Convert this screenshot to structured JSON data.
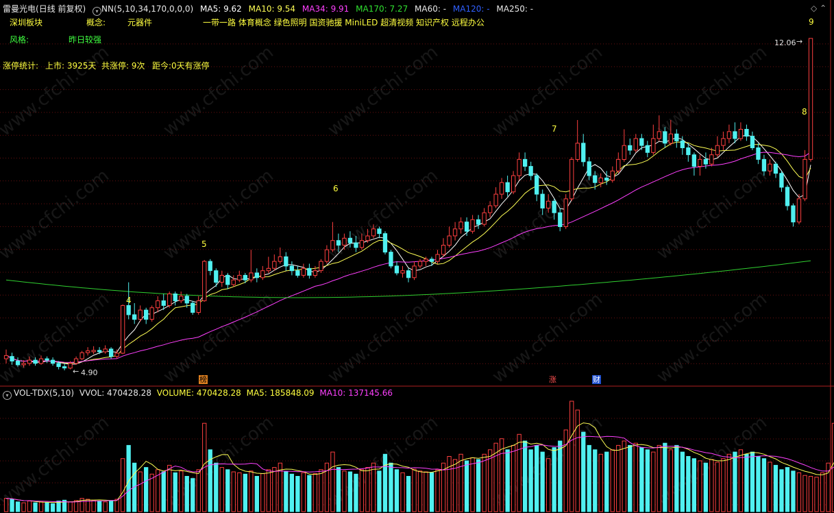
{
  "colors": {
    "up": "#ff4040",
    "down": "#50f0f0",
    "ma5": "#ffffff",
    "ma10": "#ffff55",
    "ma34": "#ff40ff",
    "ma170": "#30d030",
    "ma60": "#cccccc",
    "ma120": "#3060ff",
    "ma250": "#cccccc",
    "grid": "#6a1010",
    "yellow": "#ffff40",
    "green": "#40ff40"
  },
  "header": {
    "stock_name": "雷曼光电",
    "mode": "(日线 前复权)",
    "indicator": "NN(5,10,34,170,0,0,0)",
    "ma5": "MA5: 9.62",
    "ma10": "MA10: 9.54",
    "ma34": "MA34: 9.91",
    "ma170": "MA170: 7.27",
    "ma60": "MA60: -",
    "ma120": "MA120: -",
    "ma250": "MA250: -"
  },
  "info": {
    "sector_label": "深圳板块",
    "concept_label": "概念:",
    "concept_value": "元器件",
    "concepts": "一带一路 体育概念 绿色照明 国资驰援 MiniLED 超清视频 知识产权 远程办公",
    "style_label": "风格:",
    "style_value": "昨日较强",
    "limit_stats_label": "涨停统计:",
    "listed": "上市: 3925天",
    "limit_count": "共涨停: 9次",
    "since_last": "距今:0天有涨停"
  },
  "annotations": {
    "high_price": "12.06",
    "low_price": "4.90",
    "numbers": [
      "4",
      "5",
      "6",
      "7",
      "8",
      "9"
    ],
    "markers": [
      "榜",
      "涨",
      "财"
    ]
  },
  "volume_header": {
    "name": "VOL-TDX(5,10)",
    "vvol": "VVOL: 470428.28",
    "volume": "VOLUME: 470428.28",
    "ma5": "MA5: 185848.09",
    "ma10": "MA10: 137145.66"
  },
  "watermark": "www.cfchi.com",
  "chart_data": {
    "type": "candlestick",
    "price_range": [
      4.9,
      12.06
    ],
    "candles": [
      {
        "o": 5.15,
        "c": 5.22,
        "h": 5.35,
        "l": 5.05
      },
      {
        "o": 5.2,
        "c": 5.1,
        "h": 5.28,
        "l": 5.02
      },
      {
        "o": 5.1,
        "c": 5.02,
        "h": 5.18,
        "l": 4.98
      },
      {
        "o": 5.02,
        "c": 5.05,
        "h": 5.12,
        "l": 4.96
      },
      {
        "o": 5.05,
        "c": 5.12,
        "h": 5.2,
        "l": 5.0
      },
      {
        "o": 5.12,
        "c": 5.05,
        "h": 5.18,
        "l": 5.0
      },
      {
        "o": 5.05,
        "c": 5.15,
        "h": 5.22,
        "l": 5.02
      },
      {
        "o": 5.15,
        "c": 5.12,
        "h": 5.2,
        "l": 5.06
      },
      {
        "o": 5.12,
        "c": 5.05,
        "h": 5.18,
        "l": 5.0
      },
      {
        "o": 5.05,
        "c": 4.98,
        "h": 5.1,
        "l": 4.92
      },
      {
        "o": 4.98,
        "c": 4.95,
        "h": 5.05,
        "l": 4.9
      },
      {
        "o": 4.95,
        "c": 5.05,
        "h": 5.1,
        "l": 4.92
      },
      {
        "o": 5.05,
        "c": 5.15,
        "h": 5.2,
        "l": 5.02
      },
      {
        "o": 5.15,
        "c": 5.28,
        "h": 5.32,
        "l": 5.12
      },
      {
        "o": 5.28,
        "c": 5.32,
        "h": 5.4,
        "l": 5.22
      },
      {
        "o": 5.3,
        "c": 5.33,
        "h": 5.42,
        "l": 5.25
      },
      {
        "o": 5.33,
        "c": 5.3,
        "h": 5.4,
        "l": 5.25
      },
      {
        "o": 5.3,
        "c": 5.36,
        "h": 5.44,
        "l": 5.26
      },
      {
        "o": 5.36,
        "c": 5.2,
        "h": 5.4,
        "l": 5.15
      },
      {
        "o": 5.2,
        "c": 5.27,
        "h": 5.35,
        "l": 5.15
      },
      {
        "o": 5.27,
        "c": 6.3,
        "h": 6.32,
        "l": 5.25
      },
      {
        "o": 6.3,
        "c": 6.1,
        "h": 6.8,
        "l": 6.0
      },
      {
        "o": 6.1,
        "c": 6.0,
        "h": 6.35,
        "l": 5.9
      },
      {
        "o": 6.0,
        "c": 6.2,
        "h": 6.3,
        "l": 5.95
      },
      {
        "o": 6.2,
        "c": 6.0,
        "h": 6.25,
        "l": 5.9
      },
      {
        "o": 6.0,
        "c": 6.25,
        "h": 6.3,
        "l": 5.95
      },
      {
        "o": 6.25,
        "c": 6.4,
        "h": 6.5,
        "l": 6.15
      },
      {
        "o": 6.4,
        "c": 6.3,
        "h": 6.55,
        "l": 6.2
      },
      {
        "o": 6.3,
        "c": 6.55,
        "h": 6.6,
        "l": 6.25
      },
      {
        "o": 6.55,
        "c": 6.4,
        "h": 6.6,
        "l": 6.3
      },
      {
        "o": 6.4,
        "c": 6.5,
        "h": 6.6,
        "l": 6.35
      },
      {
        "o": 6.5,
        "c": 6.35,
        "h": 6.55,
        "l": 6.25
      },
      {
        "o": 6.35,
        "c": 6.15,
        "h": 6.4,
        "l": 6.1
      },
      {
        "o": 6.15,
        "c": 6.4,
        "h": 6.5,
        "l": 6.1
      },
      {
        "o": 6.4,
        "c": 7.25,
        "h": 7.28,
        "l": 6.38
      },
      {
        "o": 7.25,
        "c": 7.05,
        "h": 7.3,
        "l": 6.95
      },
      {
        "o": 7.05,
        "c": 6.8,
        "h": 7.1,
        "l": 6.7
      },
      {
        "o": 6.8,
        "c": 6.95,
        "h": 7.05,
        "l": 6.7
      },
      {
        "o": 6.95,
        "c": 6.75,
        "h": 7.0,
        "l": 6.65
      },
      {
        "o": 6.75,
        "c": 6.85,
        "h": 6.95,
        "l": 6.7
      },
      {
        "o": 6.85,
        "c": 6.95,
        "h": 7.05,
        "l": 6.8
      },
      {
        "o": 6.95,
        "c": 6.85,
        "h": 7.0,
        "l": 6.78
      },
      {
        "o": 6.85,
        "c": 7.0,
        "h": 7.5,
        "l": 6.8
      },
      {
        "o": 7.0,
        "c": 6.9,
        "h": 7.1,
        "l": 6.8
      },
      {
        "o": 6.9,
        "c": 7.05,
        "h": 7.15,
        "l": 6.85
      },
      {
        "o": 7.05,
        "c": 7.1,
        "h": 7.35,
        "l": 7.0
      },
      {
        "o": 7.1,
        "c": 7.25,
        "h": 7.4,
        "l": 7.05
      },
      {
        "o": 7.25,
        "c": 7.35,
        "h": 7.55,
        "l": 7.2
      },
      {
        "o": 7.35,
        "c": 7.15,
        "h": 7.45,
        "l": 7.05
      },
      {
        "o": 7.15,
        "c": 7.05,
        "h": 7.25,
        "l": 6.95
      },
      {
        "o": 7.05,
        "c": 6.95,
        "h": 7.15,
        "l": 6.9
      },
      {
        "o": 6.95,
        "c": 7.1,
        "h": 7.2,
        "l": 6.9
      },
      {
        "o": 7.1,
        "c": 6.95,
        "h": 7.2,
        "l": 6.88
      },
      {
        "o": 6.95,
        "c": 7.05,
        "h": 7.15,
        "l": 6.9
      },
      {
        "o": 7.05,
        "c": 7.25,
        "h": 7.3,
        "l": 7.0
      },
      {
        "o": 7.25,
        "c": 7.5,
        "h": 7.6,
        "l": 7.2
      },
      {
        "o": 7.5,
        "c": 7.7,
        "h": 8.1,
        "l": 7.45
      },
      {
        "o": 7.7,
        "c": 7.6,
        "h": 7.85,
        "l": 7.45
      },
      {
        "o": 7.6,
        "c": 7.75,
        "h": 7.85,
        "l": 7.5
      },
      {
        "o": 7.75,
        "c": 7.65,
        "h": 7.9,
        "l": 7.55
      },
      {
        "o": 7.65,
        "c": 7.55,
        "h": 7.8,
        "l": 7.45
      },
      {
        "o": 7.55,
        "c": 7.7,
        "h": 7.85,
        "l": 7.5
      },
      {
        "o": 7.7,
        "c": 7.8,
        "h": 7.95,
        "l": 7.65
      },
      {
        "o": 7.8,
        "c": 7.95,
        "h": 8.05,
        "l": 7.75
      },
      {
        "o": 7.95,
        "c": 7.85,
        "h": 8.0,
        "l": 7.75
      },
      {
        "o": 7.85,
        "c": 7.45,
        "h": 7.9,
        "l": 7.4
      },
      {
        "o": 7.45,
        "c": 7.15,
        "h": 7.5,
        "l": 7.1
      },
      {
        "o": 7.15,
        "c": 7.0,
        "h": 7.25,
        "l": 6.95
      },
      {
        "o": 7.0,
        "c": 7.05,
        "h": 7.15,
        "l": 6.9
      },
      {
        "o": 7.05,
        "c": 6.9,
        "h": 7.1,
        "l": 6.8
      },
      {
        "o": 6.9,
        "c": 7.15,
        "h": 7.25,
        "l": 6.85
      },
      {
        "o": 7.15,
        "c": 7.25,
        "h": 7.3,
        "l": 7.1
      },
      {
        "o": 7.25,
        "c": 7.3,
        "h": 7.35,
        "l": 7.15
      },
      {
        "o": 7.3,
        "c": 7.25,
        "h": 7.35,
        "l": 7.15
      },
      {
        "o": 7.25,
        "c": 7.4,
        "h": 7.5,
        "l": 7.2
      },
      {
        "o": 7.4,
        "c": 7.6,
        "h": 7.75,
        "l": 7.35
      },
      {
        "o": 7.6,
        "c": 7.8,
        "h": 8.0,
        "l": 7.55
      },
      {
        "o": 7.8,
        "c": 7.95,
        "h": 8.1,
        "l": 7.7
      },
      {
        "o": 7.95,
        "c": 8.1,
        "h": 8.2,
        "l": 7.85
      },
      {
        "o": 8.1,
        "c": 7.9,
        "h": 8.2,
        "l": 7.8
      },
      {
        "o": 7.9,
        "c": 8.15,
        "h": 8.25,
        "l": 7.85
      },
      {
        "o": 8.15,
        "c": 8.05,
        "h": 8.25,
        "l": 7.95
      },
      {
        "o": 8.05,
        "c": 8.3,
        "h": 8.4,
        "l": 8.0
      },
      {
        "o": 8.3,
        "c": 8.45,
        "h": 8.55,
        "l": 8.2
      },
      {
        "o": 8.45,
        "c": 8.7,
        "h": 8.85,
        "l": 8.4
      },
      {
        "o": 8.7,
        "c": 8.95,
        "h": 9.05,
        "l": 8.6
      },
      {
        "o": 8.95,
        "c": 8.75,
        "h": 9.1,
        "l": 8.65
      },
      {
        "o": 8.75,
        "c": 9.1,
        "h": 9.2,
        "l": 8.7
      },
      {
        "o": 9.1,
        "c": 9.45,
        "h": 9.6,
        "l": 9.0
      },
      {
        "o": 9.45,
        "c": 9.3,
        "h": 9.6,
        "l": 9.2
      },
      {
        "o": 9.3,
        "c": 9.1,
        "h": 9.4,
        "l": 9.0
      },
      {
        "o": 9.1,
        "c": 8.7,
        "h": 9.15,
        "l": 8.55
      },
      {
        "o": 8.7,
        "c": 8.4,
        "h": 8.8,
        "l": 8.25
      },
      {
        "o": 8.4,
        "c": 8.55,
        "h": 8.7,
        "l": 8.3
      },
      {
        "o": 8.55,
        "c": 8.3,
        "h": 8.6,
        "l": 8.15
      },
      {
        "o": 8.3,
        "c": 8.0,
        "h": 8.4,
        "l": 7.9
      },
      {
        "o": 8.0,
        "c": 8.6,
        "h": 8.7,
        "l": 7.95
      },
      {
        "o": 8.6,
        "c": 9.45,
        "h": 9.5,
        "l": 8.55
      },
      {
        "o": 9.45,
        "c": 9.8,
        "h": 10.3,
        "l": 9.4
      },
      {
        "o": 9.8,
        "c": 9.4,
        "h": 10.0,
        "l": 9.3
      },
      {
        "o": 9.4,
        "c": 9.1,
        "h": 9.5,
        "l": 9.0
      },
      {
        "o": 9.1,
        "c": 8.95,
        "h": 9.2,
        "l": 8.8
      },
      {
        "o": 8.95,
        "c": 9.05,
        "h": 9.15,
        "l": 8.85
      },
      {
        "o": 9.05,
        "c": 9.0,
        "h": 9.2,
        "l": 8.9
      },
      {
        "o": 9.0,
        "c": 9.2,
        "h": 9.3,
        "l": 8.95
      },
      {
        "o": 9.2,
        "c": 9.45,
        "h": 9.6,
        "l": 9.15
      },
      {
        "o": 9.45,
        "c": 9.75,
        "h": 10.1,
        "l": 9.4
      },
      {
        "o": 9.75,
        "c": 9.65,
        "h": 9.9,
        "l": 9.55
      },
      {
        "o": 9.65,
        "c": 9.9,
        "h": 10.0,
        "l": 9.6
      },
      {
        "o": 9.9,
        "c": 9.75,
        "h": 10.0,
        "l": 9.65
      },
      {
        "o": 9.75,
        "c": 9.6,
        "h": 9.85,
        "l": 9.5
      },
      {
        "o": 9.6,
        "c": 9.9,
        "h": 10.2,
        "l": 9.55
      },
      {
        "o": 9.9,
        "c": 10.05,
        "h": 10.4,
        "l": 9.85
      },
      {
        "o": 10.05,
        "c": 9.8,
        "h": 10.15,
        "l": 9.7
      },
      {
        "o": 9.8,
        "c": 10.0,
        "h": 10.3,
        "l": 9.75
      },
      {
        "o": 10.0,
        "c": 9.85,
        "h": 10.1,
        "l": 9.7
      },
      {
        "o": 9.85,
        "c": 9.7,
        "h": 9.95,
        "l": 9.55
      },
      {
        "o": 9.7,
        "c": 9.55,
        "h": 9.8,
        "l": 9.4
      },
      {
        "o": 9.55,
        "c": 9.3,
        "h": 9.6,
        "l": 9.1
      },
      {
        "o": 9.3,
        "c": 9.45,
        "h": 9.55,
        "l": 9.1
      },
      {
        "o": 9.45,
        "c": 9.35,
        "h": 9.6,
        "l": 9.25
      },
      {
        "o": 9.35,
        "c": 9.55,
        "h": 9.7,
        "l": 9.3
      },
      {
        "o": 9.55,
        "c": 9.75,
        "h": 9.95,
        "l": 9.5
      },
      {
        "o": 9.75,
        "c": 9.9,
        "h": 10.05,
        "l": 9.65
      },
      {
        "o": 9.9,
        "c": 10.05,
        "h": 10.2,
        "l": 9.8
      },
      {
        "o": 10.05,
        "c": 9.9,
        "h": 10.25,
        "l": 9.8
      },
      {
        "o": 9.9,
        "c": 10.1,
        "h": 10.25,
        "l": 9.85
      },
      {
        "o": 10.1,
        "c": 9.95,
        "h": 10.2,
        "l": 9.85
      },
      {
        "o": 9.95,
        "c": 9.7,
        "h": 10.05,
        "l": 9.65
      },
      {
        "o": 9.7,
        "c": 9.45,
        "h": 9.8,
        "l": 9.35
      },
      {
        "o": 9.45,
        "c": 9.2,
        "h": 9.55,
        "l": 9.1
      },
      {
        "o": 9.2,
        "c": 9.35,
        "h": 9.45,
        "l": 9.1
      },
      {
        "o": 9.35,
        "c": 9.15,
        "h": 9.4,
        "l": 9.05
      },
      {
        "o": 9.15,
        "c": 8.85,
        "h": 9.2,
        "l": 8.75
      },
      {
        "o": 8.85,
        "c": 8.45,
        "h": 8.9,
        "l": 8.35
      },
      {
        "o": 8.45,
        "c": 8.1,
        "h": 8.5,
        "l": 8.0
      },
      {
        "o": 8.1,
        "c": 8.6,
        "h": 8.7,
        "l": 8.05
      },
      {
        "o": 8.6,
        "c": 9.45,
        "h": 9.65,
        "l": 8.55
      },
      {
        "o": 9.45,
        "c": 12.06,
        "h": 12.06,
        "l": 9.4
      }
    ],
    "ma_overlays": [
      "MA5",
      "MA10",
      "MA34",
      "MA170"
    ],
    "volume": [
      30,
      28,
      22,
      20,
      24,
      20,
      22,
      20,
      18,
      24,
      26,
      22,
      25,
      30,
      28,
      26,
      24,
      22,
      25,
      28,
      120,
      150,
      110,
      90,
      100,
      85,
      95,
      90,
      105,
      88,
      92,
      80,
      75,
      95,
      200,
      140,
      110,
      100,
      95,
      90,
      88,
      85,
      92,
      80,
      86,
      95,
      100,
      110,
      90,
      85,
      80,
      88,
      82,
      86,
      95,
      110,
      135,
      100,
      92,
      90,
      85,
      95,
      100,
      110,
      92,
      130,
      110,
      95,
      88,
      80,
      96,
      92,
      90,
      88,
      95,
      110,
      125,
      118,
      130,
      115,
      122,
      118,
      130,
      140,
      155,
      165,
      140,
      150,
      175,
      160,
      140,
      150,
      135,
      120,
      145,
      160,
      185,
      250,
      230,
      180,
      150,
      140,
      130,
      135,
      140,
      150,
      160,
      150,
      155,
      145,
      140,
      135,
      150,
      155,
      140,
      150,
      135,
      125,
      120,
      115,
      110,
      118,
      112,
      120,
      130,
      135,
      140,
      130,
      135,
      125,
      120,
      112,
      105,
      95,
      100,
      92,
      88,
      82,
      80,
      78,
      88,
      110,
      200
    ]
  }
}
